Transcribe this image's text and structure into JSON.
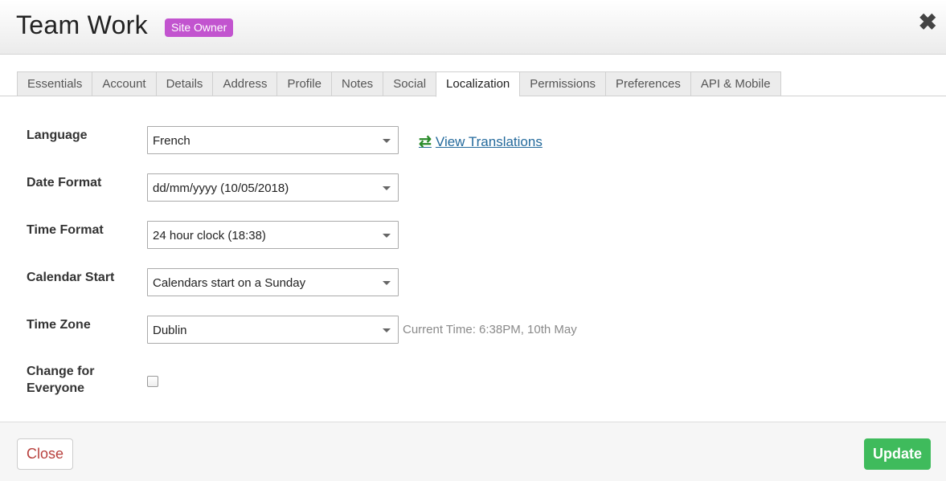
{
  "header": {
    "title": "Team Work",
    "badge": "Site Owner",
    "close_icon": "✖"
  },
  "tabs": [
    {
      "label": "Essentials",
      "active": false
    },
    {
      "label": "Account",
      "active": false
    },
    {
      "label": "Details",
      "active": false
    },
    {
      "label": "Address",
      "active": false
    },
    {
      "label": "Profile",
      "active": false
    },
    {
      "label": "Notes",
      "active": false
    },
    {
      "label": "Social",
      "active": false
    },
    {
      "label": "Localization",
      "active": true
    },
    {
      "label": "Permissions",
      "active": false
    },
    {
      "label": "Preferences",
      "active": false
    },
    {
      "label": "API & Mobile",
      "active": false
    }
  ],
  "form": {
    "language": {
      "label": "Language",
      "value": "French",
      "link_text": "View Translations",
      "link_icon": "⇄"
    },
    "date_format": {
      "label": "Date Format",
      "value": "dd/mm/yyyy (10/05/2018)"
    },
    "time_format": {
      "label": "Time Format",
      "value": "24 hour clock (18:38)"
    },
    "calendar_start": {
      "label": "Calendar Start",
      "value": "Calendars start on a Sunday"
    },
    "time_zone": {
      "label": "Time Zone",
      "value": "Dublin",
      "hint": "Current Time: 6:38PM, 10th May"
    },
    "change_for_everyone": {
      "label_line1": "Change for",
      "label_line2": "Everyone",
      "checked": false
    }
  },
  "footer": {
    "close_label": "Close",
    "update_label": "Update"
  },
  "colors": {
    "badge": "#c254cf",
    "update_button": "#3fbb5c",
    "close_button_text": "#b8403d",
    "link": "#246a9c",
    "link_icon": "#2a8b2a"
  }
}
